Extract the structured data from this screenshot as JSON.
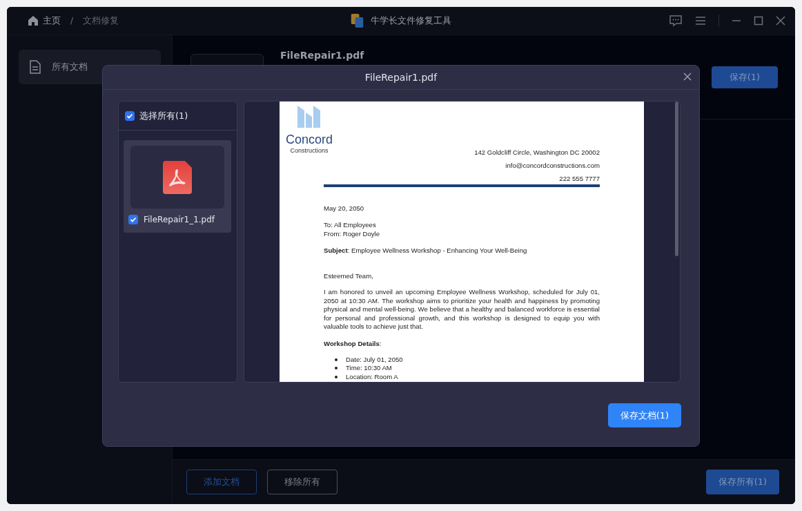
{
  "breadcrumb": [
    {
      "label": "主页",
      "kind": "home"
    },
    {
      "label": "/",
      "kind": "separator"
    },
    {
      "label": "文档修复",
      "kind": "current"
    }
  ],
  "app_title": "牛学长文件修复工具",
  "sidebar": {
    "items": [
      {
        "label": "所有文档",
        "selected": true
      }
    ]
  },
  "file": {
    "name": "FileRepair1.pdf",
    "save_button": "保存(1)"
  },
  "footer": {
    "add_button": "添加文档",
    "remove_button": "移除所有",
    "save_all_button": "保存所有(1)"
  },
  "dialog": {
    "title": "FileRepair1.pdf",
    "select_all": {
      "label": "选择所有(1)",
      "checked": true
    },
    "files": [
      {
        "name": "FileRepair1_1.pdf",
        "checked": true,
        "selected": true
      }
    ],
    "document": {
      "logo_name": "Concord",
      "logo_sub": "Constructions",
      "contact": [
        "142 Goldcliff Circle, Washington DC 20002",
        "info@concordconstructions.com",
        "222 555 7777"
      ],
      "date": "May 20, 2050",
      "to": "To: All Employees",
      "from": "From: Roger Doyle",
      "subject": "**Subject**: Employee Wellness Workshop - Enhancing Your Well-Being",
      "greeting": "Esteemed Team,",
      "body": "I am honored to unveil an upcoming Employee Wellness Workshop, scheduled for July 01, 2050 at 10:30 AM. The workshop aims to prioritize your health and happiness by promoting physical and mental well-being. We believe that a healthy and balanced workforce is essential for personal and professional growth, and this workshop is designed to equip you with valuable tools to achieve just that.",
      "section": "**Workshop Details**:",
      "bullets": [
        "Date: July 01, 2050",
        "Time: 10:30 AM",
        "Location: Room A"
      ]
    },
    "save_button": "保存文档(1)"
  }
}
